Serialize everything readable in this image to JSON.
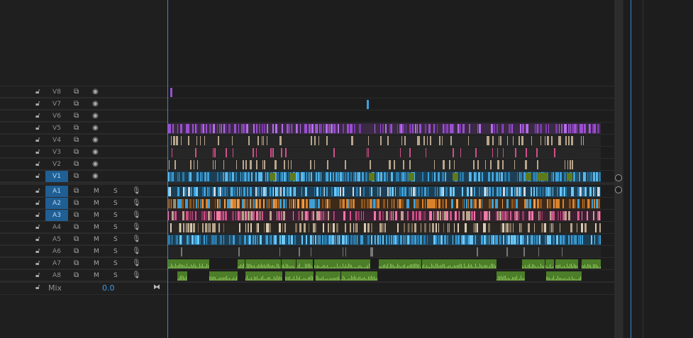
{
  "video_tracks": [
    {
      "name": "V8",
      "targeted": false
    },
    {
      "name": "V7",
      "targeted": false
    },
    {
      "name": "V6",
      "targeted": false
    },
    {
      "name": "V5",
      "targeted": false
    },
    {
      "name": "V4",
      "targeted": false
    },
    {
      "name": "V3",
      "targeted": false
    },
    {
      "name": "V2",
      "targeted": false
    },
    {
      "name": "V1",
      "targeted": true
    }
  ],
  "audio_tracks": [
    {
      "name": "A1",
      "targeted": true
    },
    {
      "name": "A2",
      "targeted": true
    },
    {
      "name": "A3",
      "targeted": true
    },
    {
      "name": "A4",
      "targeted": false
    },
    {
      "name": "A5",
      "targeted": false
    },
    {
      "name": "A6",
      "targeted": false
    },
    {
      "name": "A7",
      "targeted": false
    },
    {
      "name": "A8",
      "targeted": false
    }
  ],
  "audio_buttons": {
    "mute": "M",
    "solo": "S"
  },
  "mix": {
    "label": "Mix",
    "value": "0.0"
  },
  "icons": {
    "lock": "lock-icon",
    "sync": "sync-lock-icon",
    "eye": "eye-icon",
    "mic": "microphone-icon"
  },
  "colors": {
    "violet": "#9b4fd0",
    "cyan": "#3da0d8",
    "orange": "#d9822b",
    "pink": "#d0508a",
    "tan": "#b9a68c",
    "olive": "#5f7a1d",
    "audio_green": "#4c7d28",
    "target": "#1f5f94",
    "playhead": "#3a86d6"
  }
}
